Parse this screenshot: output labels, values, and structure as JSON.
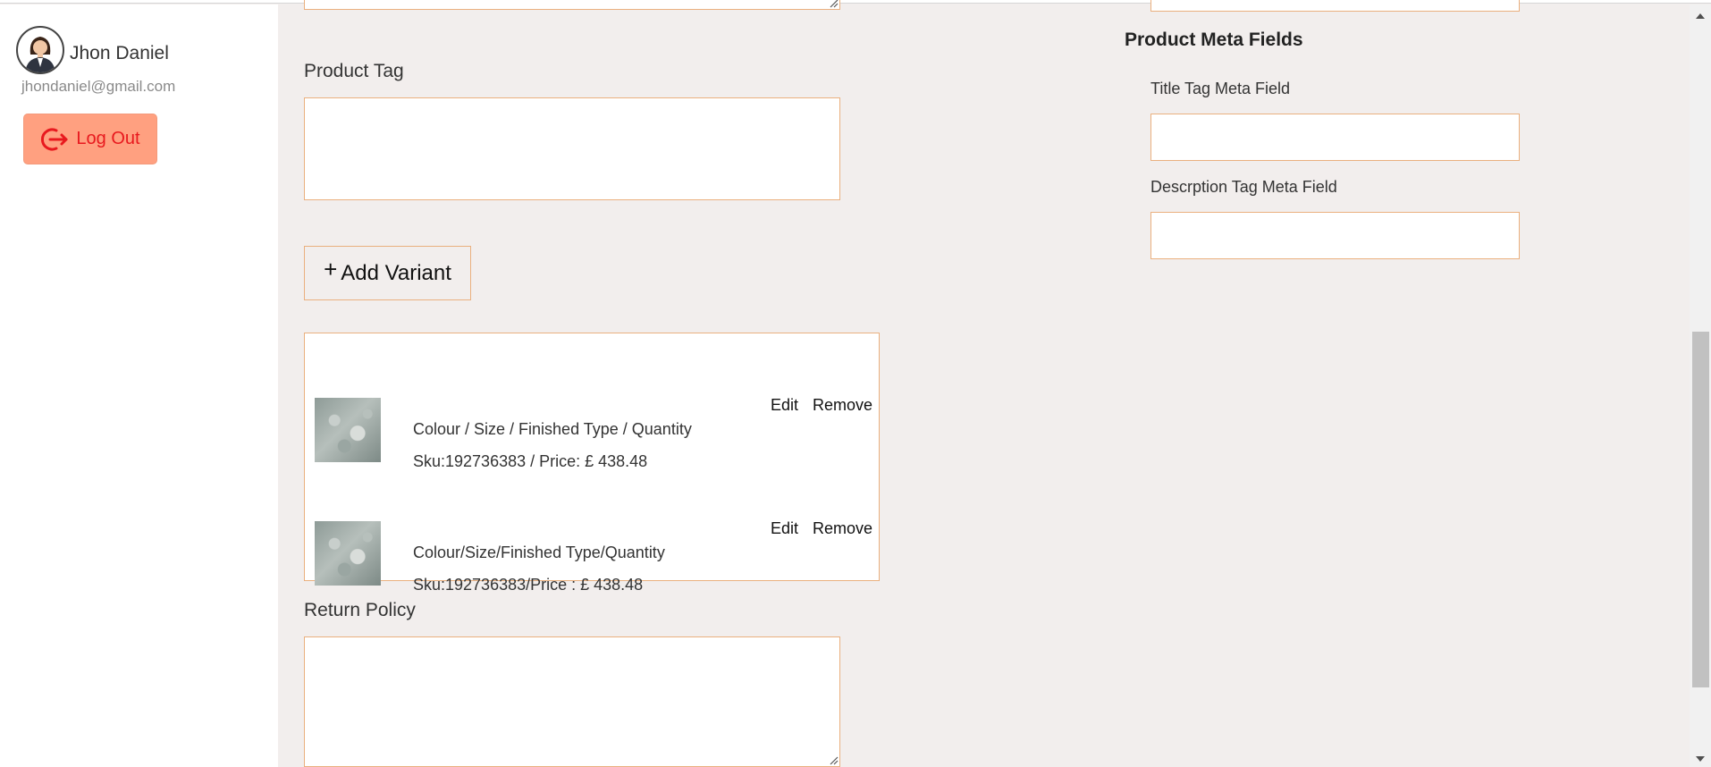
{
  "user": {
    "name": "Jhon Daniel",
    "email": "jhondaniel@gmail.com",
    "avatar_icon": "woman-avatar-icon"
  },
  "sidebar": {
    "logout_label": "Log Out",
    "logout_icon": "logout-icon"
  },
  "form": {
    "product_tag_label": "Product Tag",
    "add_variant_label": "Add Variant",
    "return_policy_label": "Return Policy"
  },
  "variants": [
    {
      "title": "Colour / Size / Finished Type / Quantity",
      "meta": "Sku:192736383 / Price: £ 438.48",
      "edit_label": "Edit",
      "remove_label": "Remove"
    },
    {
      "title": "Colour/Size/Finished Type/Quantity",
      "meta": "Sku:192736383/Price : £ 438.48",
      "edit_label": "Edit",
      "remove_label": "Remove"
    }
  ],
  "meta_fields": {
    "title": "Product Meta Fields",
    "title_tag_label": "Title Tag Meta Field",
    "description_tag_label": "Descrption Tag Meta Field"
  },
  "colors": {
    "accent_border": "#eab07f",
    "logout_bg": "#ffa080",
    "logout_text": "#e8191e",
    "page_bg": "#f2eeed"
  }
}
